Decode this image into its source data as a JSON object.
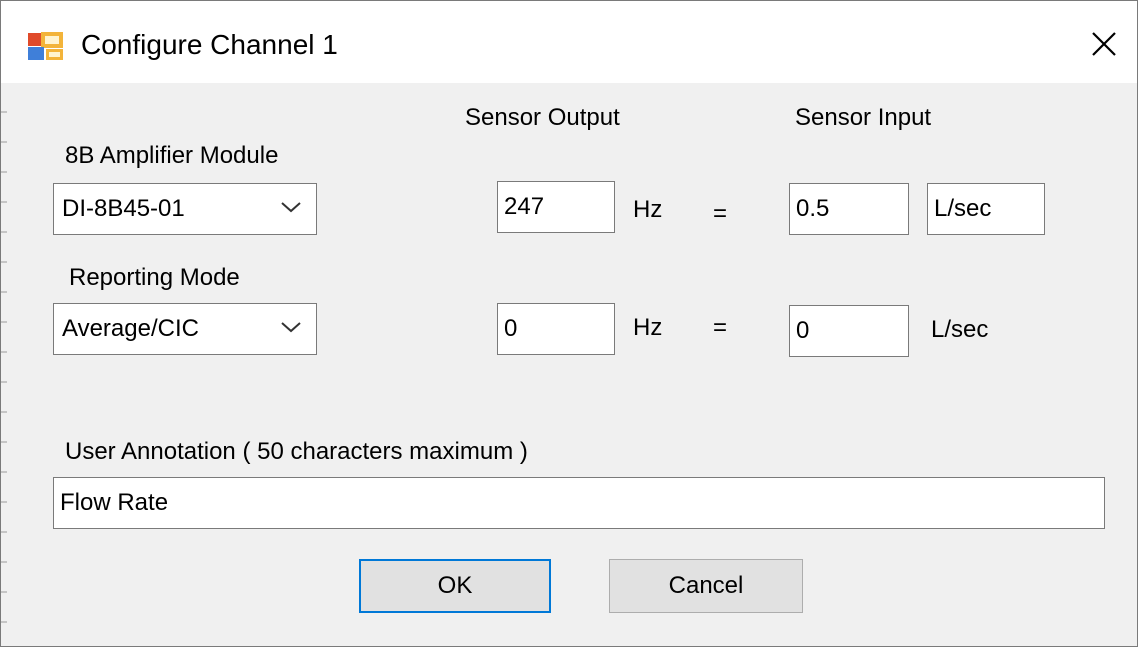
{
  "window": {
    "title": "Configure Channel 1"
  },
  "icons": {
    "app": "app-window-icon",
    "close": "close-icon",
    "dropdown": "chevron-down-icon"
  },
  "columns": {
    "sensor_output": "Sensor Output",
    "sensor_input": "Sensor Input"
  },
  "amplifier": {
    "label": "8B Amplifier Module",
    "value": "DI-8B45-01"
  },
  "reporting": {
    "label": "Reporting Mode",
    "value": "Average/CIC"
  },
  "rows": [
    {
      "output_value": "247",
      "output_unit": "Hz",
      "equals": "=",
      "input_value": "0.5",
      "input_unit": "L/sec"
    },
    {
      "output_value": "0",
      "output_unit": "Hz",
      "equals": "=",
      "input_value": "0",
      "input_unit": "L/sec"
    }
  ],
  "annotation": {
    "label": "User Annotation ( 50 characters maximum )",
    "value": "Flow Rate"
  },
  "buttons": {
    "ok": "OK",
    "cancel": "Cancel"
  },
  "colors": {
    "accent": "#0078d7",
    "dialog_background": "#f0f0f0",
    "button_face": "#e1e1e1"
  }
}
